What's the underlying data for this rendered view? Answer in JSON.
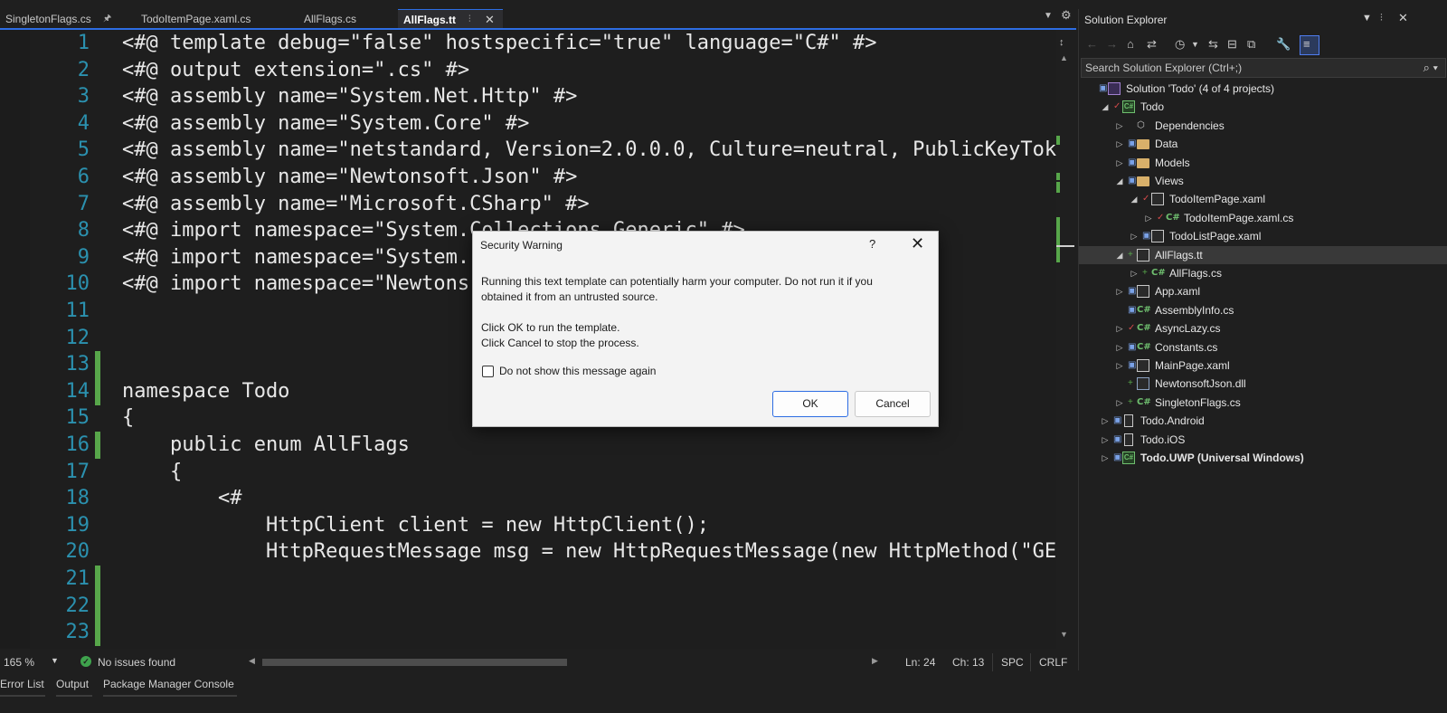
{
  "tabs": [
    {
      "label": "SingletonFlags.cs",
      "pinned": true
    },
    {
      "label": "TodoItemPage.xaml.cs"
    },
    {
      "label": "AllFlags.cs"
    },
    {
      "label": "AllFlags.tt",
      "active": true,
      "pinned": true,
      "closable": true
    }
  ],
  "editor": {
    "lines": [
      {
        "num": "1",
        "code": "<#@ template debug=\"false\" hostspecific=\"true\" language=\"C#\" #>"
      },
      {
        "num": "2",
        "code": "<#@ output extension=\".cs\" #>"
      },
      {
        "num": "3",
        "code": "<#@ assembly name=\"System.Net.Http\" #>"
      },
      {
        "num": "4",
        "code": "<#@ assembly name=\"System.Core\" #>"
      },
      {
        "num": "5",
        "code": "<#@ assembly name=\"netstandard, Version=2.0.0.0, Culture=neutral, PublicKeyTok"
      },
      {
        "num": "6",
        "code": "<#@ assembly name=\"Newtonsoft.Json\" #>"
      },
      {
        "num": "7",
        "code": "<#@ assembly name=\"Microsoft.CSharp\" #>"
      },
      {
        "num": "8",
        "code": "<#@ import namespace=\"System.Collections.Generic\" #>"
      },
      {
        "num": "9",
        "code": "<#@ import namespace=\"System."
      },
      {
        "num": "10",
        "code": "<#@ import namespace=\"Newtons"
      },
      {
        "num": "11",
        "code": ""
      },
      {
        "num": "12",
        "code": ""
      },
      {
        "num": "13",
        "code": ""
      },
      {
        "num": "14",
        "code": "namespace Todo"
      },
      {
        "num": "15",
        "code": "{"
      },
      {
        "num": "16",
        "code": "    public enum AllFlags"
      },
      {
        "num": "17",
        "code": "    {"
      },
      {
        "num": "18",
        "code": "        <#"
      },
      {
        "num": "19",
        "code": "            HttpClient client = new HttpClient();"
      },
      {
        "num": "20",
        "code": "            HttpRequestMessage msg = new HttpRequestMessage(new HttpMethod(\"GE"
      },
      {
        "num": "21",
        "code": ""
      },
      {
        "num": "22",
        "code": ""
      },
      {
        "num": "23",
        "code": ""
      }
    ],
    "changed_lines": [
      "13",
      "14",
      "16",
      "21",
      "22",
      "23"
    ]
  },
  "status": {
    "zoom": "165 %",
    "issues": "No issues found",
    "line": "Ln: 24",
    "col": "Ch: 13",
    "whitespace": "SPC",
    "line_ending": "CRLF"
  },
  "bottom_tabs": [
    "Error List",
    "Output",
    "Package Manager Console"
  ],
  "solution_explorer": {
    "title": "Solution Explorer",
    "search_placeholder": "Search Solution Explorer (Ctrl+;)",
    "nodes": [
      {
        "label": "Solution 'Todo' (4 of 4 projects)",
        "icon": "solution-icon",
        "level": 0,
        "state": "lock"
      },
      {
        "label": "Todo",
        "icon": "csharp-project-icon",
        "level": 1,
        "expanded": true,
        "state": "check"
      },
      {
        "label": "Dependencies",
        "icon": "dependencies-icon",
        "level": 2,
        "expandable": true
      },
      {
        "label": "Data",
        "icon": "folder-icon",
        "level": 2,
        "expandable": true,
        "state": "lock"
      },
      {
        "label": "Models",
        "icon": "folder-icon",
        "level": 2,
        "expandable": true,
        "state": "lock"
      },
      {
        "label": "Views",
        "icon": "folder-icon",
        "level": 2,
        "expanded": true,
        "state": "lock"
      },
      {
        "label": "TodoItemPage.xaml",
        "icon": "xaml-file-icon",
        "level": 3,
        "expanded": true,
        "state": "check"
      },
      {
        "label": "TodoItemPage.xaml.cs",
        "icon": "csharp-file-icon",
        "level": 4,
        "expandable": true,
        "state": "check"
      },
      {
        "label": "TodoListPage.xaml",
        "icon": "xaml-file-icon",
        "level": 3,
        "expandable": true,
        "state": "lock"
      },
      {
        "label": "AllFlags.tt",
        "icon": "text-template-icon",
        "level": 2,
        "expanded": true,
        "state": "plus",
        "selected": true
      },
      {
        "label": "AllFlags.cs",
        "icon": "csharp-file-icon",
        "level": 3,
        "expandable": true,
        "state": "plus"
      },
      {
        "label": "App.xaml",
        "icon": "xaml-file-icon",
        "level": 2,
        "expandable": true,
        "state": "lock"
      },
      {
        "label": "AssemblyInfo.cs",
        "icon": "csharp-file-icon",
        "level": 2,
        "state": "lock"
      },
      {
        "label": "AsyncLazy.cs",
        "icon": "csharp-file-icon",
        "level": 2,
        "expandable": true,
        "state": "check"
      },
      {
        "label": "Constants.cs",
        "icon": "csharp-file-icon",
        "level": 2,
        "expandable": true,
        "state": "lock"
      },
      {
        "label": "MainPage.xaml",
        "icon": "xaml-file-icon",
        "level": 2,
        "expandable": true,
        "state": "lock"
      },
      {
        "label": "NewtonsoftJson.dll",
        "icon": "library-icon",
        "level": 2,
        "state": "plus"
      },
      {
        "label": "SingletonFlags.cs",
        "icon": "csharp-file-icon",
        "level": 2,
        "expandable": true,
        "state": "plus"
      },
      {
        "label": "Todo.Android",
        "icon": "mobile-project-icon",
        "level": 1,
        "expandable": true,
        "state": "lock"
      },
      {
        "label": "Todo.iOS",
        "icon": "mobile-project-icon",
        "level": 1,
        "expandable": true,
        "state": "lock"
      },
      {
        "label": "Todo.UWP (Universal Windows)",
        "icon": "csharp-project-icon",
        "level": 1,
        "expandable": true,
        "state": "lock",
        "bold": true
      }
    ]
  },
  "dialog": {
    "title": "Security Warning",
    "help": "?",
    "line1": "Running this text template can potentially harm your computer. Do not run it if you",
    "line2": "obtained it from an untrusted source.",
    "line3": "Click OK to run the template.",
    "line4": "Click Cancel to stop the process.",
    "checkbox_label": "Do not show this message again",
    "checkbox_checked": false,
    "ok_label": "OK",
    "cancel_label": "Cancel"
  }
}
